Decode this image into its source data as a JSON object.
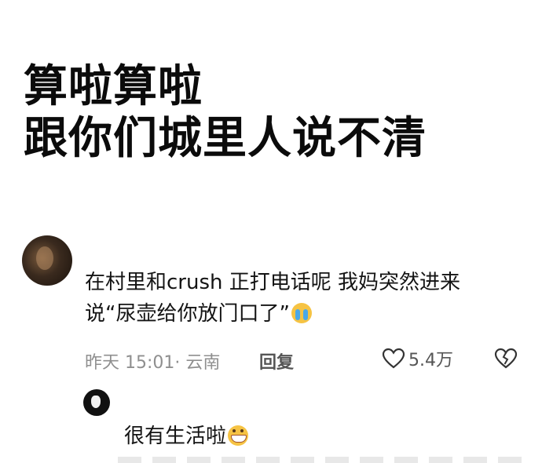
{
  "headline": {
    "line1": "算啦算啦",
    "line2": "跟你们城里人说不清"
  },
  "comment": {
    "avatar_icon": "user-avatar-icon",
    "text_line1": "在村里和crush 正打电话呢 我妈突然进来",
    "text_line2": "说“尿壶给你放门口了”",
    "emoji": "crying-face-emoji",
    "time_location": "昨天 15:01· 云南",
    "reply_label": "回复",
    "like_count": "5.4万",
    "like_icon": "heart-outline-icon",
    "dislike_icon": "broken-heart-icon"
  },
  "reply": {
    "avatar_icon": "reply-avatar-icon",
    "text": "很有生活啦",
    "emoji": "grinning-face-emoji"
  }
}
